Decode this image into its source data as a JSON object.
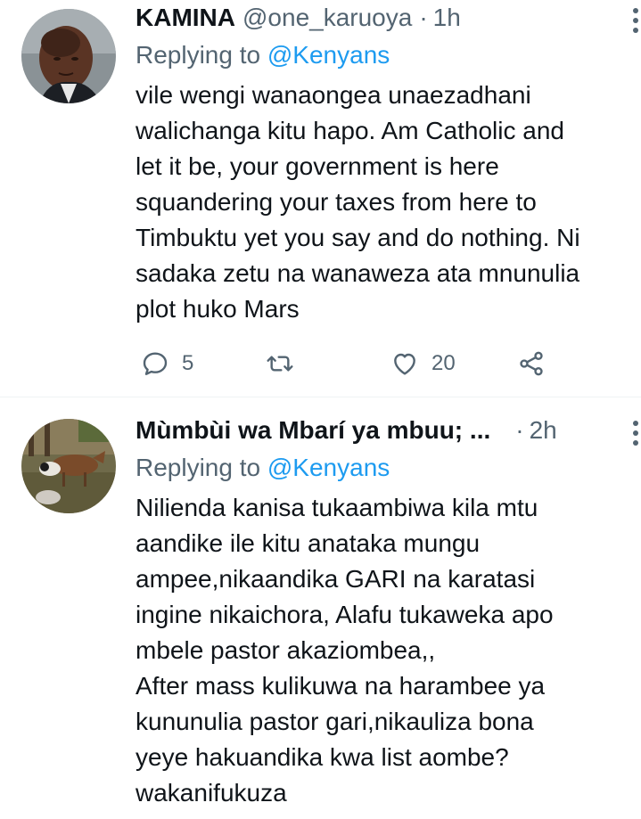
{
  "tweets": [
    {
      "name": "KAMINA",
      "handle": "@one_karuoya",
      "dot": "·",
      "time": "1h",
      "replying_prefix": "Replying to",
      "replying_to": "@Kenyans",
      "text": "vile wengi wanaongea unaezadhani\nwalichanga kitu hapo. Am Catholic and\nlet it be, your government is here\nsquandering your taxes from here to\nTimbuktu yet you say and do nothing. Ni\nsadaka zetu na wanaweza ata mnunulia\nplot huko Mars",
      "actions": {
        "replies": "5",
        "retweets": "",
        "likes": "20"
      },
      "icons": [
        "reply-icon",
        "retweet-icon",
        "like-icon",
        "share-icon"
      ]
    },
    {
      "name": "Mùmbùi wa Mbarí ya mbuu; ...",
      "handle": "",
      "dot": "·",
      "time": "2h",
      "replying_prefix": "Replying to",
      "replying_to": "@Kenyans",
      "text": "Nilienda kanisa tukaambiwa kila mtu\naandike ile kitu anataka mungu\nampee,nikaandika GARI na karatasi\ningine nikaichora, Alafu tukaweka apo\nmbele pastor akaziombea,,\nAfter mass kulikuwa na harambee ya\nkununulia pastor gari,nikauliza bona\nyeye hakuandika kwa list aombe?\nwakanifukuza"
    }
  ],
  "colors": {
    "text_primary": "#0f1419",
    "text_secondary": "#536471",
    "mention": "#1d9bf0",
    "divider": "#eff3f4"
  }
}
